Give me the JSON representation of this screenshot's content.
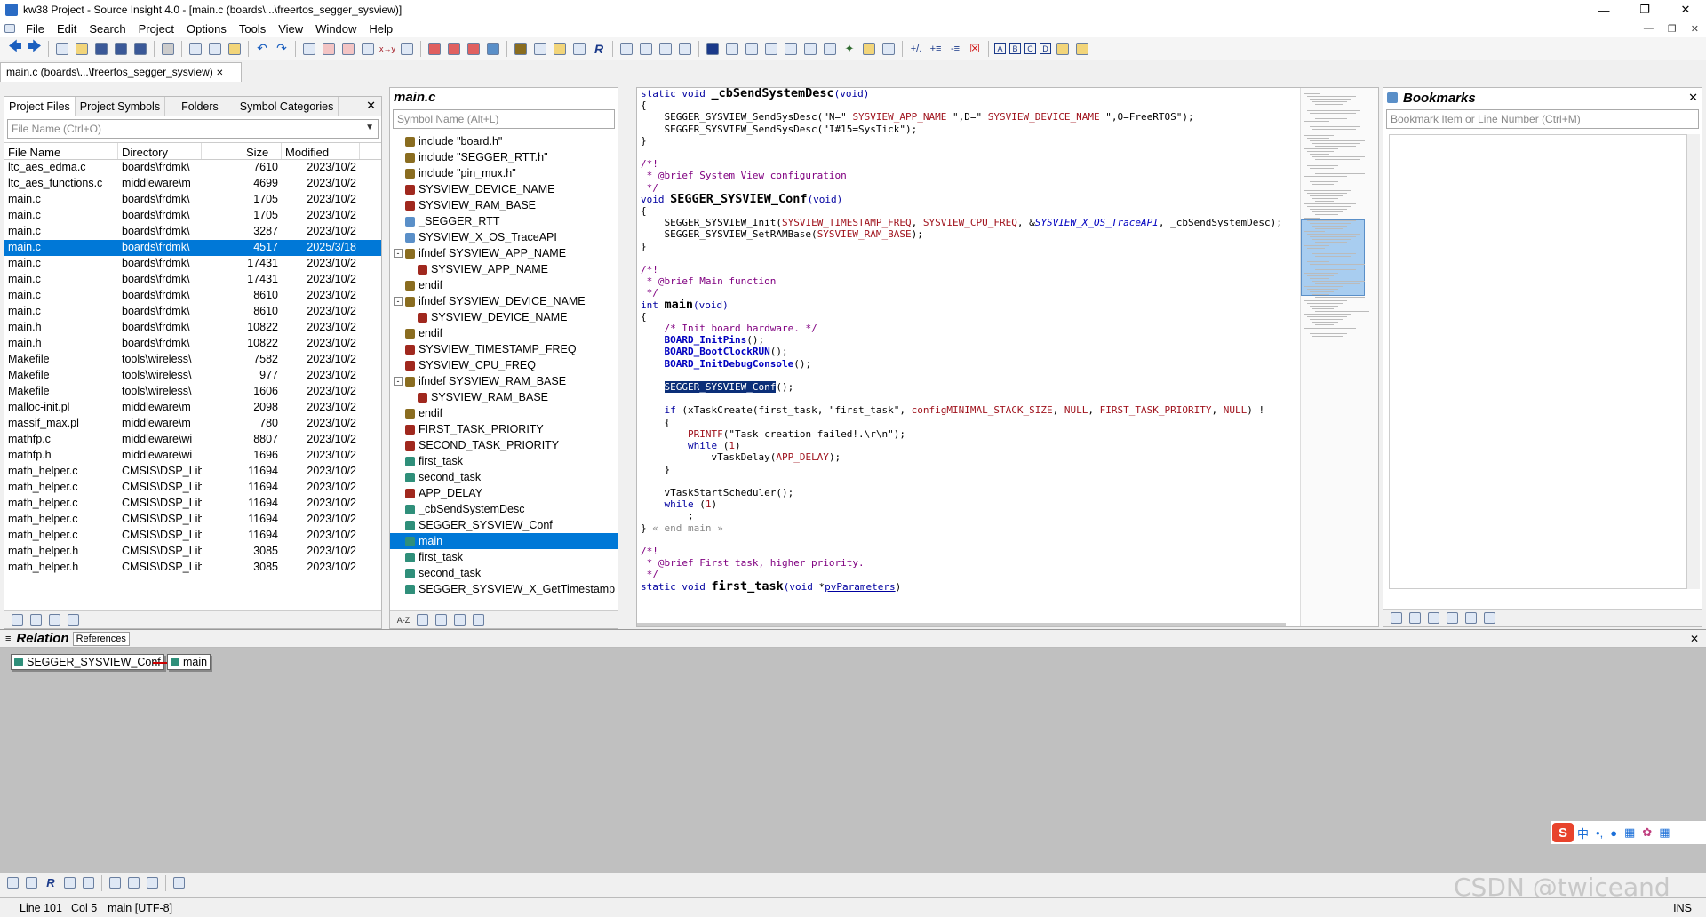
{
  "window": {
    "title": "kw38 Project - Source Insight 4.0 - [main.c (boards\\...\\freertos_segger_sysview)]"
  },
  "menu": [
    "File",
    "Edit",
    "Search",
    "Project",
    "Options",
    "Tools",
    "View",
    "Window",
    "Help"
  ],
  "file_tab": "main.c (boards\\...\\freertos_segger_sysview)",
  "project_panel": {
    "tabs": [
      "Project Files",
      "Project Symbols",
      "Folders",
      "Symbol Categories"
    ],
    "filter_placeholder": "File Name (Ctrl+O)",
    "columns": [
      "File Name",
      "Directory",
      "Size",
      "Modified"
    ],
    "rows": [
      [
        "ltc_aes_edma.c",
        "boards\\frdmk\\",
        "7610",
        "2023/10/2"
      ],
      [
        "ltc_aes_functions.c",
        "middleware\\m",
        "4699",
        "2023/10/2"
      ],
      [
        "main.c",
        "boards\\frdmk\\",
        "1705",
        "2023/10/2"
      ],
      [
        "main.c",
        "boards\\frdmk\\",
        "1705",
        "2023/10/2"
      ],
      [
        "main.c",
        "boards\\frdmk\\",
        "3287",
        "2023/10/2"
      ],
      [
        "main.c",
        "boards\\frdmk\\",
        "4517",
        "2025/3/18"
      ],
      [
        "main.c",
        "boards\\frdmk\\",
        "17431",
        "2023/10/2"
      ],
      [
        "main.c",
        "boards\\frdmk\\",
        "17431",
        "2023/10/2"
      ],
      [
        "main.c",
        "boards\\frdmk\\",
        "8610",
        "2023/10/2"
      ],
      [
        "main.c",
        "boards\\frdmk\\",
        "8610",
        "2023/10/2"
      ],
      [
        "main.h",
        "boards\\frdmk\\",
        "10822",
        "2023/10/2"
      ],
      [
        "main.h",
        "boards\\frdmk\\",
        "10822",
        "2023/10/2"
      ],
      [
        "Makefile",
        "tools\\wireless\\",
        "7582",
        "2023/10/2"
      ],
      [
        "Makefile",
        "tools\\wireless\\",
        "977",
        "2023/10/2"
      ],
      [
        "Makefile",
        "tools\\wireless\\",
        "1606",
        "2023/10/2"
      ],
      [
        "malloc-init.pl",
        "middleware\\m",
        "2098",
        "2023/10/2"
      ],
      [
        "massif_max.pl",
        "middleware\\m",
        "780",
        "2023/10/2"
      ],
      [
        "mathfp.c",
        "middleware\\wi",
        "8807",
        "2023/10/2"
      ],
      [
        "mathfp.h",
        "middleware\\wi",
        "1696",
        "2023/10/2"
      ],
      [
        "math_helper.c",
        "CMSIS\\DSP_Lib",
        "11694",
        "2023/10/2"
      ],
      [
        "math_helper.c",
        "CMSIS\\DSP_Lib",
        "11694",
        "2023/10/2"
      ],
      [
        "math_helper.c",
        "CMSIS\\DSP_Lib",
        "11694",
        "2023/10/2"
      ],
      [
        "math_helper.c",
        "CMSIS\\DSP_Lib",
        "11694",
        "2023/10/2"
      ],
      [
        "math_helper.c",
        "CMSIS\\DSP_Lib",
        "11694",
        "2023/10/2"
      ],
      [
        "math_helper.h",
        "CMSIS\\DSP_Lib",
        "3085",
        "2023/10/2"
      ],
      [
        "math_helper.h",
        "CMSIS\\DSP_Lib",
        "3085",
        "2023/10/2"
      ]
    ]
  },
  "symbol_panel": {
    "title": "main.c",
    "search_placeholder": "Symbol Name (Alt+L)",
    "items": [
      {
        "label": "include \"board.h\"",
        "type": "inc",
        "indent": 0,
        "exp": ""
      },
      {
        "label": "include \"SEGGER_RTT.h\"",
        "type": "inc",
        "indent": 0,
        "exp": ""
      },
      {
        "label": "include \"pin_mux.h\"",
        "type": "inc",
        "indent": 0,
        "exp": ""
      },
      {
        "label": "SYSVIEW_DEVICE_NAME",
        "type": "def",
        "indent": 0,
        "exp": ""
      },
      {
        "label": "SYSVIEW_RAM_BASE",
        "type": "def",
        "indent": 0,
        "exp": ""
      },
      {
        "label": "_SEGGER_RTT",
        "type": "var",
        "indent": 0,
        "exp": ""
      },
      {
        "label": "SYSVIEW_X_OS_TraceAPI",
        "type": "var",
        "indent": 0,
        "exp": ""
      },
      {
        "label": "ifndef SYSVIEW_APP_NAME",
        "type": "inc",
        "indent": 0,
        "exp": "-"
      },
      {
        "label": "SYSVIEW_APP_NAME",
        "type": "def",
        "indent": 1,
        "exp": ""
      },
      {
        "label": "endif",
        "type": "inc",
        "indent": 0,
        "exp": ""
      },
      {
        "label": "ifndef SYSVIEW_DEVICE_NAME",
        "type": "inc",
        "indent": 0,
        "exp": "-"
      },
      {
        "label": "SYSVIEW_DEVICE_NAME",
        "type": "def",
        "indent": 1,
        "exp": ""
      },
      {
        "label": "endif",
        "type": "inc",
        "indent": 0,
        "exp": ""
      },
      {
        "label": "SYSVIEW_TIMESTAMP_FREQ",
        "type": "def",
        "indent": 0,
        "exp": ""
      },
      {
        "label": "SYSVIEW_CPU_FREQ",
        "type": "def",
        "indent": 0,
        "exp": ""
      },
      {
        "label": "ifndef SYSVIEW_RAM_BASE",
        "type": "inc",
        "indent": 0,
        "exp": "-"
      },
      {
        "label": "SYSVIEW_RAM_BASE",
        "type": "def",
        "indent": 1,
        "exp": ""
      },
      {
        "label": "endif",
        "type": "inc",
        "indent": 0,
        "exp": ""
      },
      {
        "label": "FIRST_TASK_PRIORITY",
        "type": "def",
        "indent": 0,
        "exp": ""
      },
      {
        "label": "SECOND_TASK_PRIORITY",
        "type": "def",
        "indent": 0,
        "exp": ""
      },
      {
        "label": "first_task",
        "type": "fn",
        "indent": 0,
        "exp": ""
      },
      {
        "label": "second_task",
        "type": "fn",
        "indent": 0,
        "exp": ""
      },
      {
        "label": "APP_DELAY",
        "type": "def",
        "indent": 0,
        "exp": ""
      },
      {
        "label": "_cbSendSystemDesc",
        "type": "fn",
        "indent": 0,
        "exp": ""
      },
      {
        "label": "SEGGER_SYSVIEW_Conf",
        "type": "fn",
        "indent": 0,
        "exp": ""
      },
      {
        "label": "main",
        "type": "fn",
        "indent": 0,
        "exp": "",
        "sel": true
      },
      {
        "label": "first_task",
        "type": "fn",
        "indent": 0,
        "exp": ""
      },
      {
        "label": "second_task",
        "type": "fn",
        "indent": 0,
        "exp": ""
      },
      {
        "label": "SEGGER_SYSVIEW_X_GetTimestamp",
        "type": "fn",
        "indent": 0,
        "exp": ""
      }
    ]
  },
  "bookmarks": {
    "title": "Bookmarks",
    "placeholder": "Bookmark Item or Line Number (Ctrl+M)"
  },
  "relation": {
    "title": "Relation",
    "tab": "References",
    "node_a": "SEGGER_SYSVIEW_Conf",
    "node_b": "main"
  },
  "status": {
    "line": "Line 101",
    "col": "Col 5",
    "context": "main [UTF-8]",
    "mode": "INS"
  },
  "watermark": "CSDN @twiceand",
  "ime": {
    "badge": "S",
    "zh": "中"
  }
}
